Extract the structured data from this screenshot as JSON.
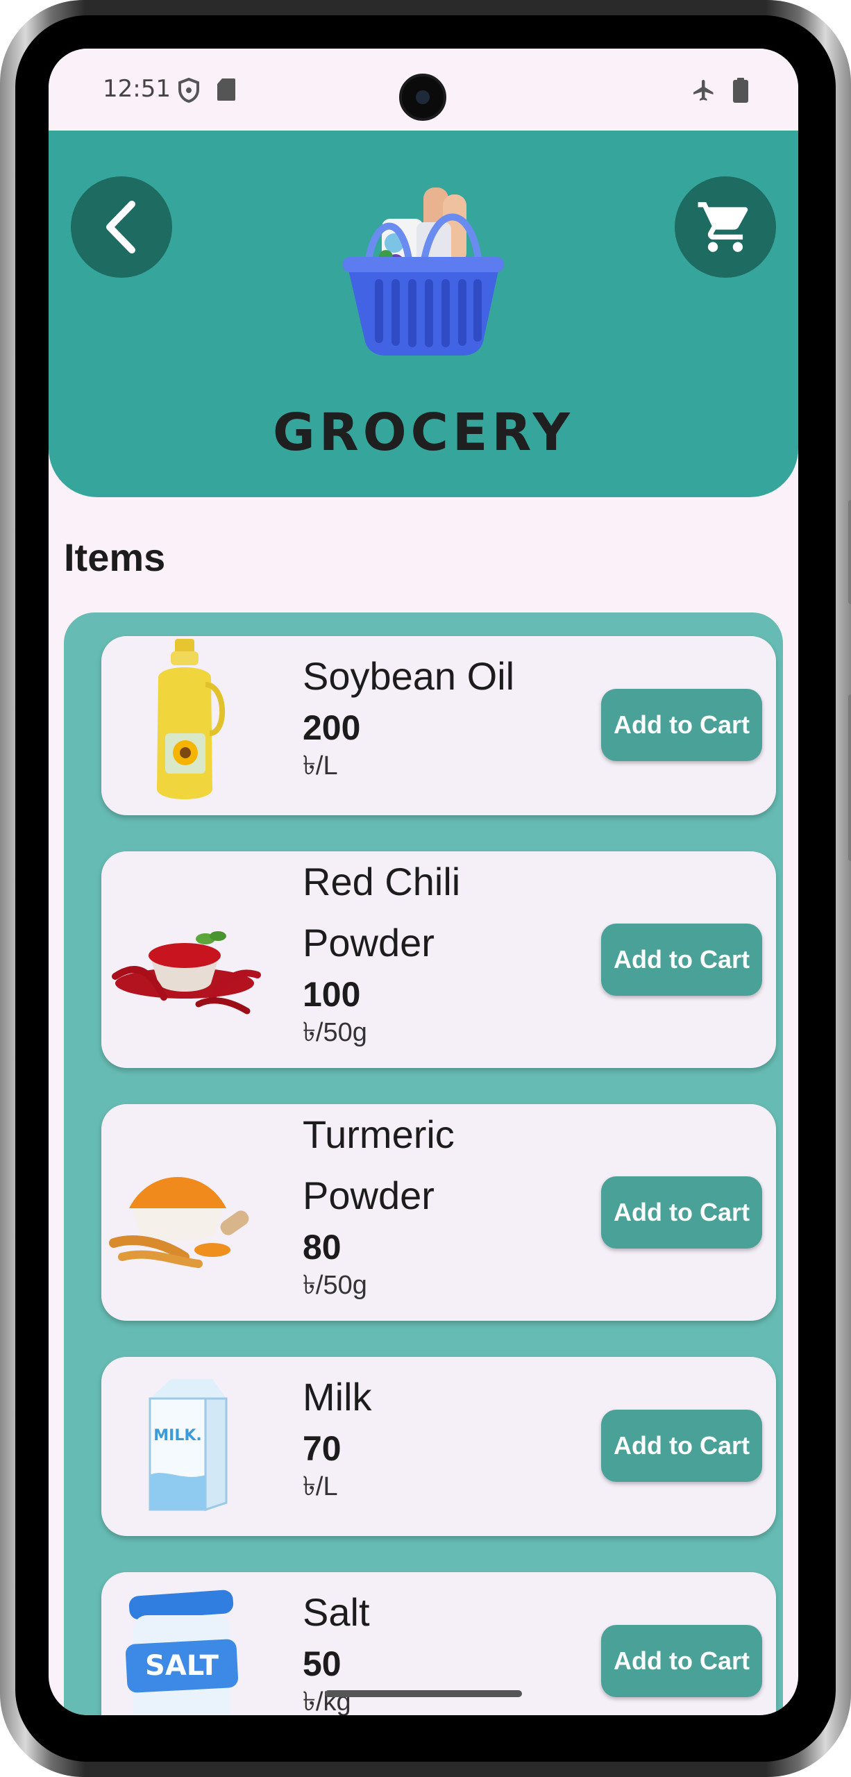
{
  "status_bar": {
    "time": "12:51"
  },
  "header": {
    "title": "GROCERY"
  },
  "section": {
    "title": "Items"
  },
  "items": [
    {
      "name": "Soybean Oil",
      "price": "200",
      "unit": "৳/L",
      "button": "Add to Cart"
    },
    {
      "name": "Red Chili Powder",
      "price": "100",
      "unit": "৳/50g",
      "button": "Add to Cart"
    },
    {
      "name": "Turmeric Powder",
      "price": "80",
      "unit": "৳/50g",
      "button": "Add to Cart"
    },
    {
      "name": "Milk",
      "price": "70",
      "unit": "৳/L",
      "button": "Add to Cart"
    },
    {
      "name": "Salt",
      "price": "50",
      "unit": "৳/kg",
      "button": "Add to Cart"
    }
  ],
  "images": {
    "milk_carton_text": "MILK.",
    "salt_label_text": "SALT"
  },
  "colors": {
    "header": "#36a69d",
    "panel": "#66bcb4",
    "button": "#4aa197",
    "round_button": "#1e6b61",
    "background": "#fbf2f9"
  },
  "icons": [
    "back-arrow-icon",
    "cart-icon",
    "basket-icon",
    "shield-icon",
    "sd-card-icon",
    "airplane-icon",
    "battery-icon"
  ]
}
